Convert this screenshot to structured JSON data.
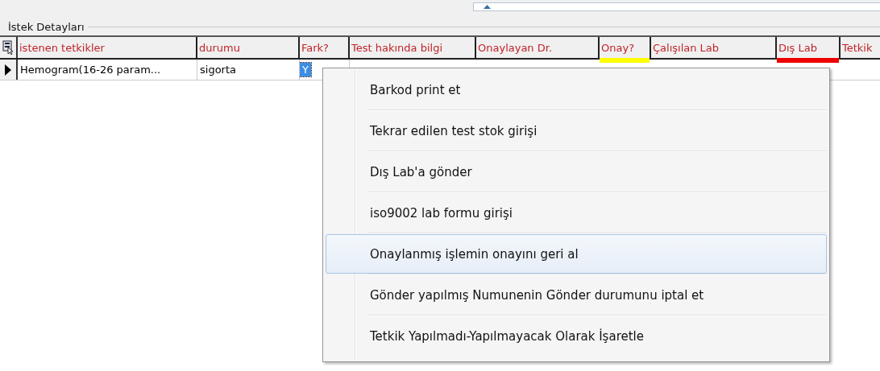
{
  "group_title": "İstek Detayları",
  "table": {
    "columns": [
      {
        "label": "istenen tetkikler"
      },
      {
        "label": "durumu"
      },
      {
        "label": "Fark?"
      },
      {
        "label": "Test hakında bilgi"
      },
      {
        "label": "Onaylayan Dr."
      },
      {
        "label": "Onay?",
        "color": "#ffff00"
      },
      {
        "label": "Çalışılan Lab"
      },
      {
        "label": "Dış Lab",
        "color": "#ee0000"
      },
      {
        "label": "Tetkik"
      }
    ],
    "rows": [
      {
        "cells": [
          {
            "text": "Hemogram(16-26 param...",
            "selected": false
          },
          {
            "text": "sigorta",
            "selected": false
          },
          {
            "text": "Y",
            "selected": true
          }
        ]
      }
    ]
  },
  "context_menu": [
    {
      "label": "Barkod print et",
      "selected": false
    },
    {
      "label": "Tekrar edilen test stok girişi",
      "selected": false
    },
    {
      "label": "Dış Lab'a gönder",
      "selected": false
    },
    {
      "label": "iso9002 lab formu girişi",
      "selected": false
    },
    {
      "label": "Onaylanmış işlemin onayını geri al",
      "selected": true
    },
    {
      "label": "Gönder yapılmış Numunenin Gönder durumunu iptal et",
      "selected": false
    },
    {
      "label": "Tetkik Yapılmadı-Yapılmayacak Olarak İşaretle",
      "selected": false
    }
  ]
}
